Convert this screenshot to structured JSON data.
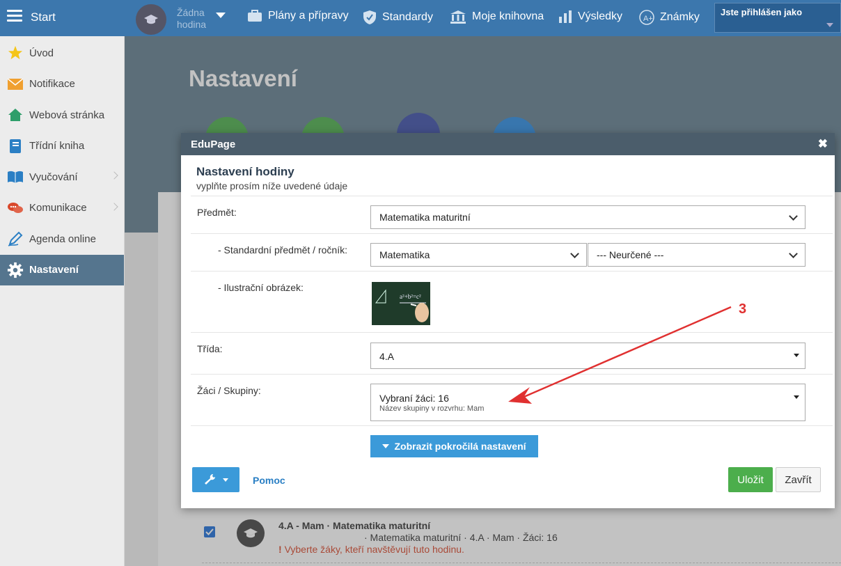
{
  "topbar": {
    "menu_label": "Start",
    "lesson_label": "Žádna hodina",
    "nav": [
      {
        "label": "Plány a přípravy",
        "icon": "briefcase-icon"
      },
      {
        "label": "Standardy",
        "icon": "shield-check-icon"
      },
      {
        "label": "Moje knihovna",
        "icon": "library-icon"
      },
      {
        "label": "Výsledky",
        "icon": "bar-chart-icon"
      },
      {
        "label": "Známky",
        "icon": "grade-icon"
      }
    ],
    "user_label": "Jste přihlášen jako"
  },
  "sidebar": {
    "items": [
      {
        "label": "Úvod",
        "icon": "star-icon"
      },
      {
        "label": "Notifikace",
        "icon": "envelope-icon"
      },
      {
        "label": "Webová stránka",
        "icon": "home-icon"
      },
      {
        "label": "Třídní kniha",
        "icon": "book-icon"
      },
      {
        "label": "Vyučování",
        "icon": "open-book-icon"
      },
      {
        "label": "Komunikace",
        "icon": "chat-icon"
      },
      {
        "label": "Agenda online",
        "icon": "pen-icon"
      },
      {
        "label": "Nastavení",
        "icon": "gear-icon"
      }
    ],
    "active_index": 7
  },
  "page": {
    "title": "Nastavení"
  },
  "dialog": {
    "header": "EduPage",
    "title": "Nastavení hodiny",
    "subtitle": "vyplňte prosím níže uvedené údaje",
    "fields": {
      "subject_label": "Předmět:",
      "subject_value": "Matematika maturitní",
      "standard_label": "- Standardní předmět / ročník:",
      "standard_subject_value": "Matematika",
      "standard_grade_value": "--- Neurčené ---",
      "image_label": "- Ilustrační obrázek:",
      "class_label": "Třída:",
      "class_value": "4.A",
      "students_label": "Žáci / Skupiny:",
      "students_value": "Vybraní žáci: 16",
      "students_group": "Název skupiny v rozvrhu: Mam"
    },
    "advanced_button": "Zobrazit pokročilá nastavení",
    "help_label": "Pomoc",
    "save_label": "Uložit",
    "close_label": "Zavřít"
  },
  "annotation": {
    "number": "3",
    "color": "#e03030"
  },
  "lesson_row": {
    "title": "4.A - Mam · Matematika maturitní",
    "info": "· Matematika maturitní · 4.A · Mam · Žáci: 16",
    "warning_mark": "!",
    "warning": "Vyberte žáky, kteří navštěvují tuto hodinu."
  },
  "colors": {
    "topbar": "#3c77ad",
    "active_sidebar": "#55758e",
    "primary_button": "#3b9ad9",
    "save_button": "#4cae4c"
  }
}
